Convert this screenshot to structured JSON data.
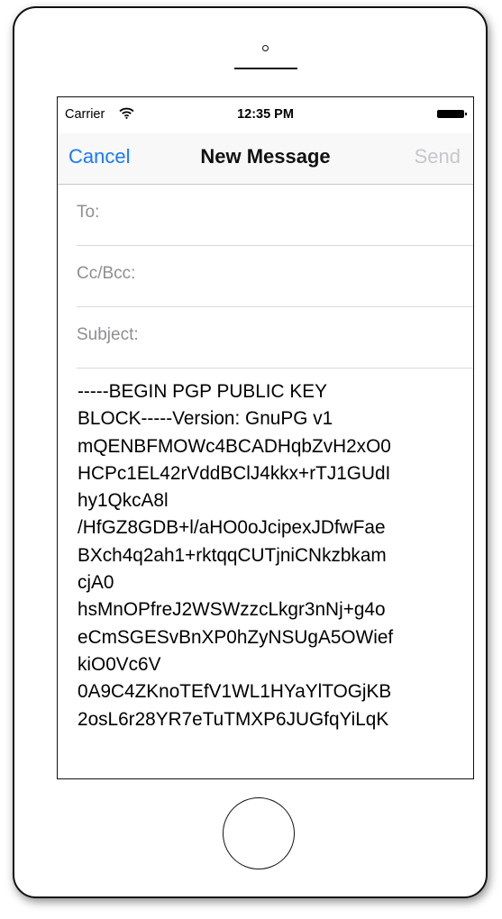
{
  "status": {
    "carrier": "Carrier",
    "time": "12:35 PM"
  },
  "nav": {
    "cancel": "Cancel",
    "title": "New Message",
    "send": "Send"
  },
  "fields": {
    "to": "To:",
    "ccbcc": "Cc/Bcc:",
    "subject": "Subject:"
  },
  "body": {
    "lines": [
      "-----BEGIN PGP PUBLIC KEY",
      "BLOCK-----Version: GnuPG v1",
      "mQENBFMOWc4BCADHqbZvH2xO0",
      "HCPc1EL42rVddBClJ4kkx+rTJ1GUdI",
      "hy1QkcA8l",
      "/HfGZ8GDB+l/aHO0oJcipexJDfwFae",
      "BXch4q2ah1+rktqqCUTjniCNkzbkam",
      "cjA0",
      "hsMnOPfreJ2WSWzzcLkgr3nNj+g4o",
      "eCmSGESvBnXP0hZyNSUgA5OWief",
      "kiO0Vc6V",
      "0A9C4ZKnoTEfV1WL1HYaYlTOGjKB",
      "2osL6r28YR7eTuTMXP6JUGfqYiLqK"
    ]
  },
  "icons": {
    "wifi": "wifi-icon",
    "battery": "battery-icon"
  }
}
